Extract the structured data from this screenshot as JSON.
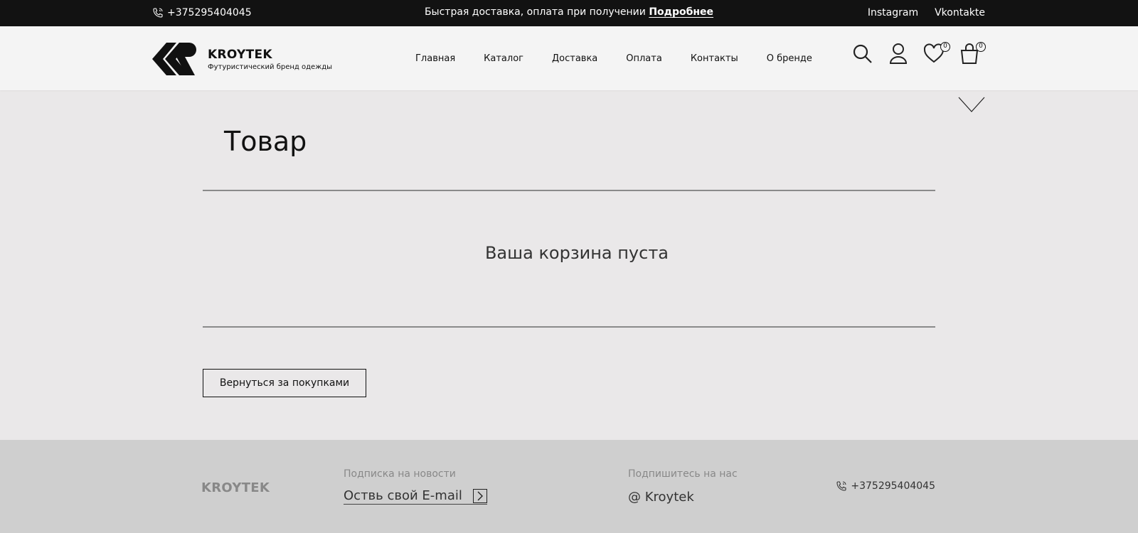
{
  "topbar": {
    "phone": "+375295404045",
    "promo_text": "Быстрая доставка, оплата при получении",
    "promo_link": "Подробнее",
    "social": [
      "Instagram",
      "Vkontakte"
    ]
  },
  "header": {
    "brand": "KROYTEK",
    "tagline": "Футуристический бренд одежды",
    "nav": [
      "Главная",
      "Каталог",
      "Доставка",
      "Оплата",
      "Контакты",
      "О бренде"
    ],
    "wishlist_count": "0",
    "cart_count": "0"
  },
  "main": {
    "title": "Товар",
    "empty_message": "Ваша корзина пуста",
    "back_button": "Вернуться за покупками"
  },
  "footer": {
    "brand": "KROYTEK",
    "subscribe_label": "Подписка на новости",
    "email_placeholder": "Оствь свой E-mail",
    "follow_label": "Подпишитесь на нас",
    "follow_handle": "@ Kroytek",
    "phone": "+375295404045"
  }
}
